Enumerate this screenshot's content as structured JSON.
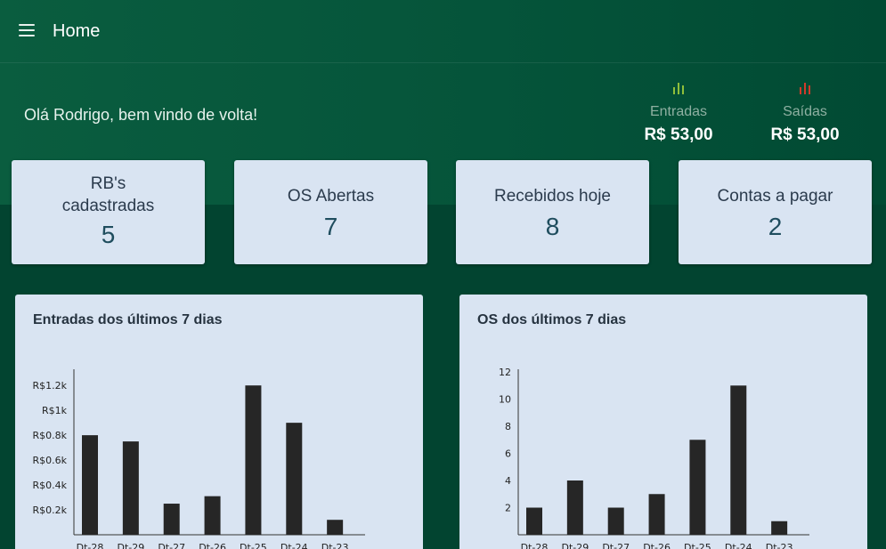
{
  "header": {
    "title": "Home"
  },
  "greeting": "Olá Rodrigo, bem vindo de volta!",
  "summary": {
    "entradas": {
      "label": "Entradas",
      "value": "R$ 53,00",
      "icon": "bar-chart-icon",
      "color": "#8fbf3a"
    },
    "saidas": {
      "label": "Saídas",
      "value": "R$ 53,00",
      "icon": "bar-chart-icon",
      "color": "#d23a2a"
    }
  },
  "cards": [
    {
      "title": "RB's cadastradas",
      "value": "5"
    },
    {
      "title": "OS Abertas",
      "value": "7"
    },
    {
      "title": "Recebidos hoje",
      "value": "8"
    },
    {
      "title": "Contas a pagar",
      "value": "2"
    }
  ],
  "chart_data": [
    {
      "type": "bar",
      "title": "Entradas dos últimos 7 dias",
      "categories": [
        "Dt-28",
        "Dt-29",
        "Dt-27",
        "Dt-26",
        "Dt-25",
        "Dt-24",
        "Dt-23"
      ],
      "values": [
        800,
        750,
        250,
        310,
        1200,
        900,
        120
      ],
      "ylim": [
        0,
        1330
      ],
      "yticks": [
        200,
        400,
        600,
        800,
        1000,
        1200
      ],
      "ytick_labels": [
        "R$0.2k",
        "R$0.4k",
        "R$0.6k",
        "R$0.8k",
        "R$1k",
        "R$1.2k"
      ],
      "grid": false,
      "color": "#262626"
    },
    {
      "type": "bar",
      "title": "OS dos últimos 7 dias",
      "categories": [
        "Dt-28",
        "Dt-29",
        "Dt-27",
        "Dt-26",
        "Dt-25",
        "Dt-24",
        "Dt-23"
      ],
      "values": [
        2,
        4,
        2,
        3,
        7,
        11,
        1
      ],
      "ylim": [
        0,
        12.2
      ],
      "yticks": [
        2,
        4,
        6,
        8,
        10,
        12
      ],
      "ytick_labels": [
        "2",
        "4",
        "6",
        "8",
        "10",
        "12"
      ],
      "grid": false,
      "color": "#262626"
    }
  ]
}
